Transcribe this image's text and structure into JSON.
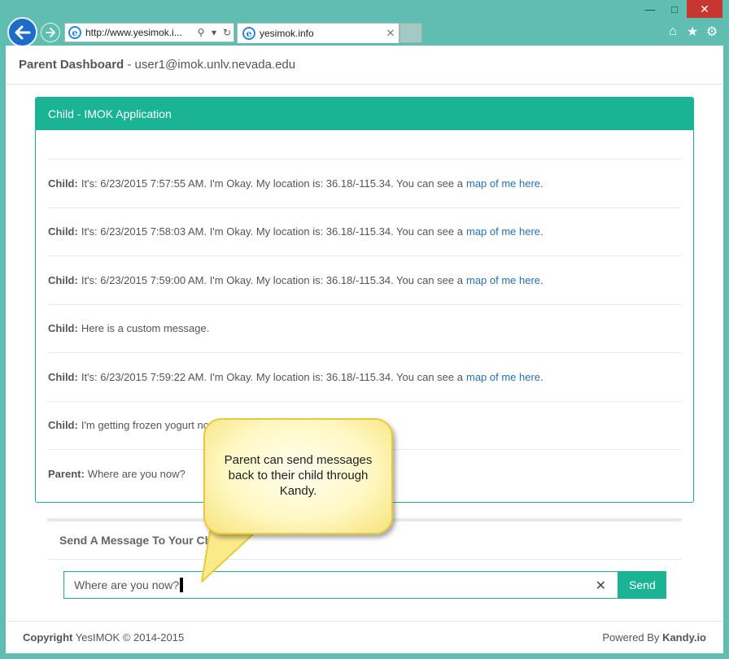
{
  "browser": {
    "address_url": "http://www.yesimok.i...",
    "tab_title": "yesimok.info",
    "window_controls": [
      "minimize",
      "maximize",
      "close"
    ],
    "icons": [
      "back-arrow-icon",
      "forward-arrow-icon",
      "ie-logo-icon",
      "search-icon",
      "dropdown-icon",
      "refresh-icon",
      "tab-close-icon",
      "home-icon",
      "favorites-star-icon",
      "settings-gear-icon"
    ]
  },
  "header": {
    "brand": "Parent Dashboard",
    "separator": " - ",
    "user": "user1@imok.unlv.nevada.edu"
  },
  "panel": {
    "title": "Child - IMOK Application",
    "messages": [
      {
        "sender": "Child:",
        "text": "It's: 6/23/2015 7:57:55 AM. I'm Okay. My location is: 36.18/-115.34. You can see a",
        "link": "map of me here",
        "suffix": "."
      },
      {
        "sender": "Child:",
        "text": "It's: 6/23/2015 7:58:03 AM. I'm Okay. My location is: 36.18/-115.34. You can see a",
        "link": "map of me here",
        "suffix": "."
      },
      {
        "sender": "Child:",
        "text": "It's: 6/23/2015 7:59:00 AM. I'm Okay. My location is: 36.18/-115.34. You can see a",
        "link": "map of me here",
        "suffix": "."
      },
      {
        "sender": "Child:",
        "text": "Here is a custom message."
      },
      {
        "sender": "Child:",
        "text": "It's: 6/23/2015 7:59:22 AM. I'm Okay. My location is: 36.18/-115.34. You can see a",
        "link": "map of me here",
        "suffix": "."
      },
      {
        "sender": "Child:",
        "text": "I'm getting frozen yogurt no"
      },
      {
        "sender": "Parent:",
        "text": "Where are you now?"
      }
    ]
  },
  "send": {
    "title": "Send A Message To Your Child",
    "input_value": "Where are you now?",
    "clear_icon": "clear-x-icon",
    "button_label": "Send"
  },
  "footer": {
    "copyright_label": "Copyright",
    "copyright_text": "YesIMOK © 2014-2015",
    "powered_label": "Powered By",
    "powered_brand": "Kandy.io"
  },
  "callout": {
    "text": "Parent can send messages back to their child through Kandy."
  },
  "colors": {
    "accent": "#1ab394",
    "chrome": "#5fbdb1",
    "link": "#2a6ebb",
    "close_button": "#c7372f",
    "callout_fill": "#fff8c4",
    "callout_border": "#e9c93a"
  }
}
